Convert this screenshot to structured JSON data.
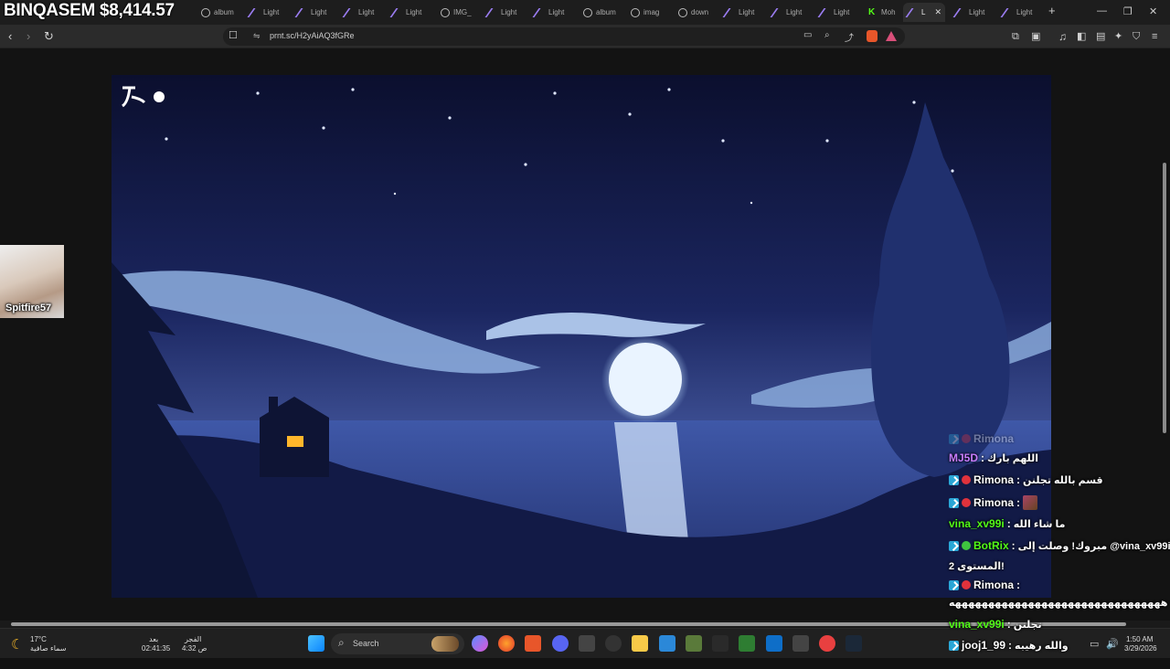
{
  "overlay": {
    "ticker": "BINQASEM $8,414.57"
  },
  "tabs": [
    {
      "label": "Light",
      "icon": "pen-icon"
    },
    {
      "label": "album",
      "icon": "globe-icon"
    },
    {
      "label": "Light",
      "icon": "pen-icon"
    },
    {
      "label": "Light",
      "icon": "pen-icon"
    },
    {
      "label": "Light",
      "icon": "pen-icon"
    },
    {
      "label": "Light",
      "icon": "pen-icon"
    },
    {
      "label": "IMG_",
      "icon": "globe-icon"
    },
    {
      "label": "Light",
      "icon": "pen-icon"
    },
    {
      "label": "Light",
      "icon": "pen-icon"
    },
    {
      "label": "album",
      "icon": "globe-icon"
    },
    {
      "label": "imag",
      "icon": "globe-icon"
    },
    {
      "label": "down",
      "icon": "globe-icon"
    },
    {
      "label": "Light",
      "icon": "pen-icon"
    },
    {
      "label": "Light",
      "icon": "pen-icon"
    },
    {
      "label": "Light",
      "icon": "pen-icon"
    },
    {
      "label": "Moh",
      "icon": "kick-icon"
    },
    {
      "label": "L",
      "icon": "pen-icon",
      "active": true
    },
    {
      "label": "Light",
      "icon": "pen-icon"
    },
    {
      "label": "Light",
      "icon": "pen-icon"
    }
  ],
  "new_tab": "+",
  "window": {
    "minimize": "—",
    "restore": "❐",
    "close": "✕"
  },
  "toolbar": {
    "url": "prnt.sc/H2yAiAQ3fGRe"
  },
  "webcam": {
    "name": "Spitfire57"
  },
  "chat": {
    "faded_user": "Rimona",
    "messages": [
      {
        "user": "MJ5D",
        "color": "#c77dff",
        "text": "اللهم بارك",
        "badges": []
      },
      {
        "user": "Rimona",
        "color": "#ffffff",
        "text": "قسم بالله تجلنن",
        "badges": [
          "mod",
          "red"
        ]
      },
      {
        "user": "Rimona",
        "color": "#ffffff",
        "text": "",
        "badges": [
          "mod",
          "red"
        ],
        "emote": true
      },
      {
        "user": "vina_xv99i",
        "color": "#53fc18",
        "text": "ما شاء الله",
        "badges": []
      },
      {
        "user": "BotRix",
        "color": "#53fc18",
        "text": "مبروك! وصلت إلى @vina_xv99i",
        "badges": [
          "mod",
          "green"
        ]
      },
      {
        "user": "",
        "color": "#ffffff",
        "text": "المستوى 2!",
        "badges": []
      },
      {
        "user": "Rimona",
        "color": "#ffffff",
        "text": "",
        "badges": [
          "mod",
          "red"
        ]
      },
      {
        "user": "",
        "color": "#ffffff",
        "text": "ههههههههههههههههههههههههههههههههه",
        "badges": []
      },
      {
        "user": "vina_xv99i",
        "color": "#53fc18",
        "text": "تجلنن",
        "badges": []
      },
      {
        "user": "jooj1_99",
        "color": "#ffffff",
        "text": "والله رهيبه",
        "badges": [
          "mod"
        ]
      }
    ]
  },
  "taskbar": {
    "weather_temp": "17°C",
    "weather_desc": "سماء صافية",
    "prayer1_label": "بعد",
    "prayer1_time": "02:41:35",
    "prayer2_label": "الفجر",
    "prayer2_time": "4:32 ص",
    "search_label": "Search",
    "clock_time": "1:50 AM",
    "clock_date": "3/29/2026"
  }
}
